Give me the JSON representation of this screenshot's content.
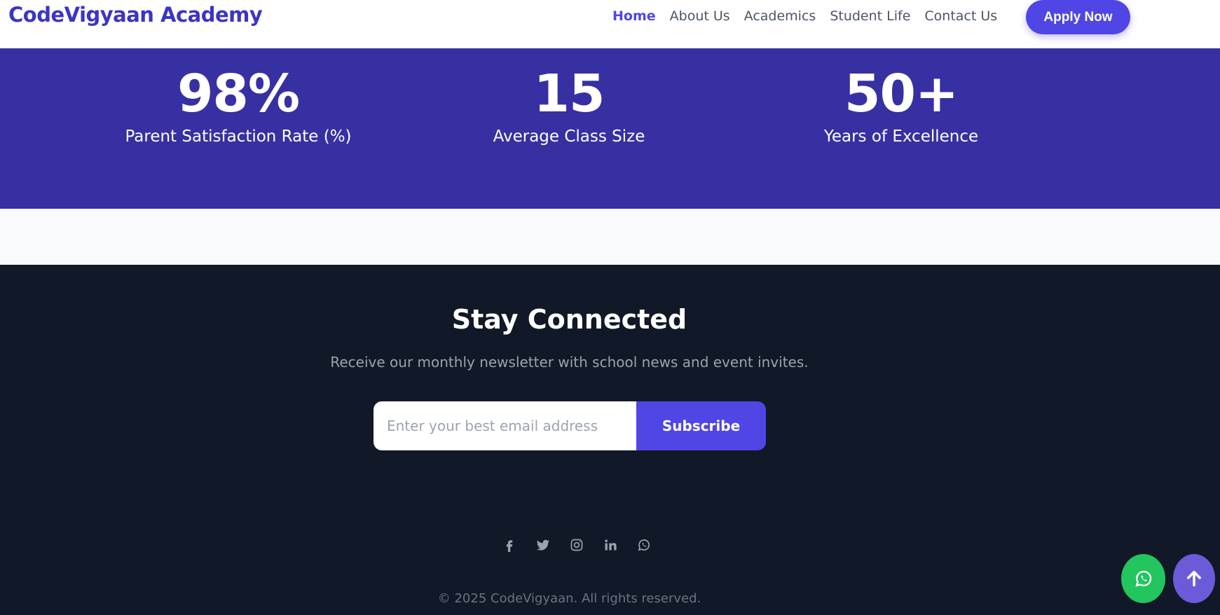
{
  "header": {
    "brand": "CodeVigyaan Academy",
    "nav": [
      {
        "label": "Home",
        "active": true
      },
      {
        "label": "About Us",
        "active": false
      },
      {
        "label": "Academics",
        "active": false
      },
      {
        "label": "Student Life",
        "active": false
      },
      {
        "label": "Contact Us",
        "active": false
      }
    ],
    "cta_label": "Apply Now"
  },
  "stats": [
    {
      "value": "98%",
      "label": "Parent Satisfaction Rate (%)"
    },
    {
      "value": "15",
      "label": "Average Class Size"
    },
    {
      "value": "50+",
      "label": "Years of Excellence"
    }
  ],
  "newsletter": {
    "title": "Stay Connected",
    "subtitle": "Receive our monthly newsletter with school news and event invites.",
    "email_placeholder": "Enter your best email address",
    "email_value": "",
    "button_label": "Subscribe"
  },
  "social_icons": [
    "facebook-icon",
    "twitter-icon",
    "instagram-icon",
    "linkedin-icon",
    "whatsapp-icon"
  ],
  "footer": {
    "copyright": "© 2025 CodeVigyaan. All rights reserved."
  },
  "floating": {
    "whatsapp_icon": "whatsapp-icon",
    "scroll_top_icon": "arrow-up-icon"
  },
  "colors": {
    "brand": "#3b35c4",
    "accent": "#4f46e5",
    "stats_bg": "#3730a3",
    "footer_bg": "#111827",
    "whatsapp": "#22c55e",
    "scroll_top": "#6b5bd9"
  }
}
